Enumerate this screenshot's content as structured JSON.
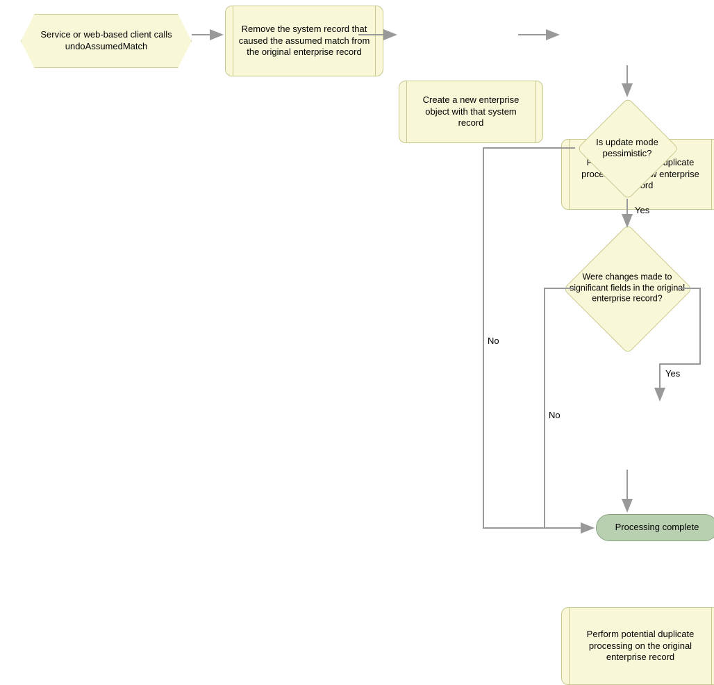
{
  "nodes": {
    "start": "Service or web-based client calls undoAssumedMatch",
    "remove": "Remove the system record that caused the assumed match from the original enterprise record",
    "create": "Create a new enterprise object with that system record",
    "dup_new": "Perform potential duplicate processing on new enterprise record",
    "dec_mode": "Is update mode pessimistic?",
    "dec_changes": "Were changes made to significant fields in the original enterprise record?",
    "dup_orig": "Perform potential duplicate processing on the original enterprise record",
    "end": "Processing complete"
  },
  "labels": {
    "yes": "Yes",
    "no": "No"
  }
}
